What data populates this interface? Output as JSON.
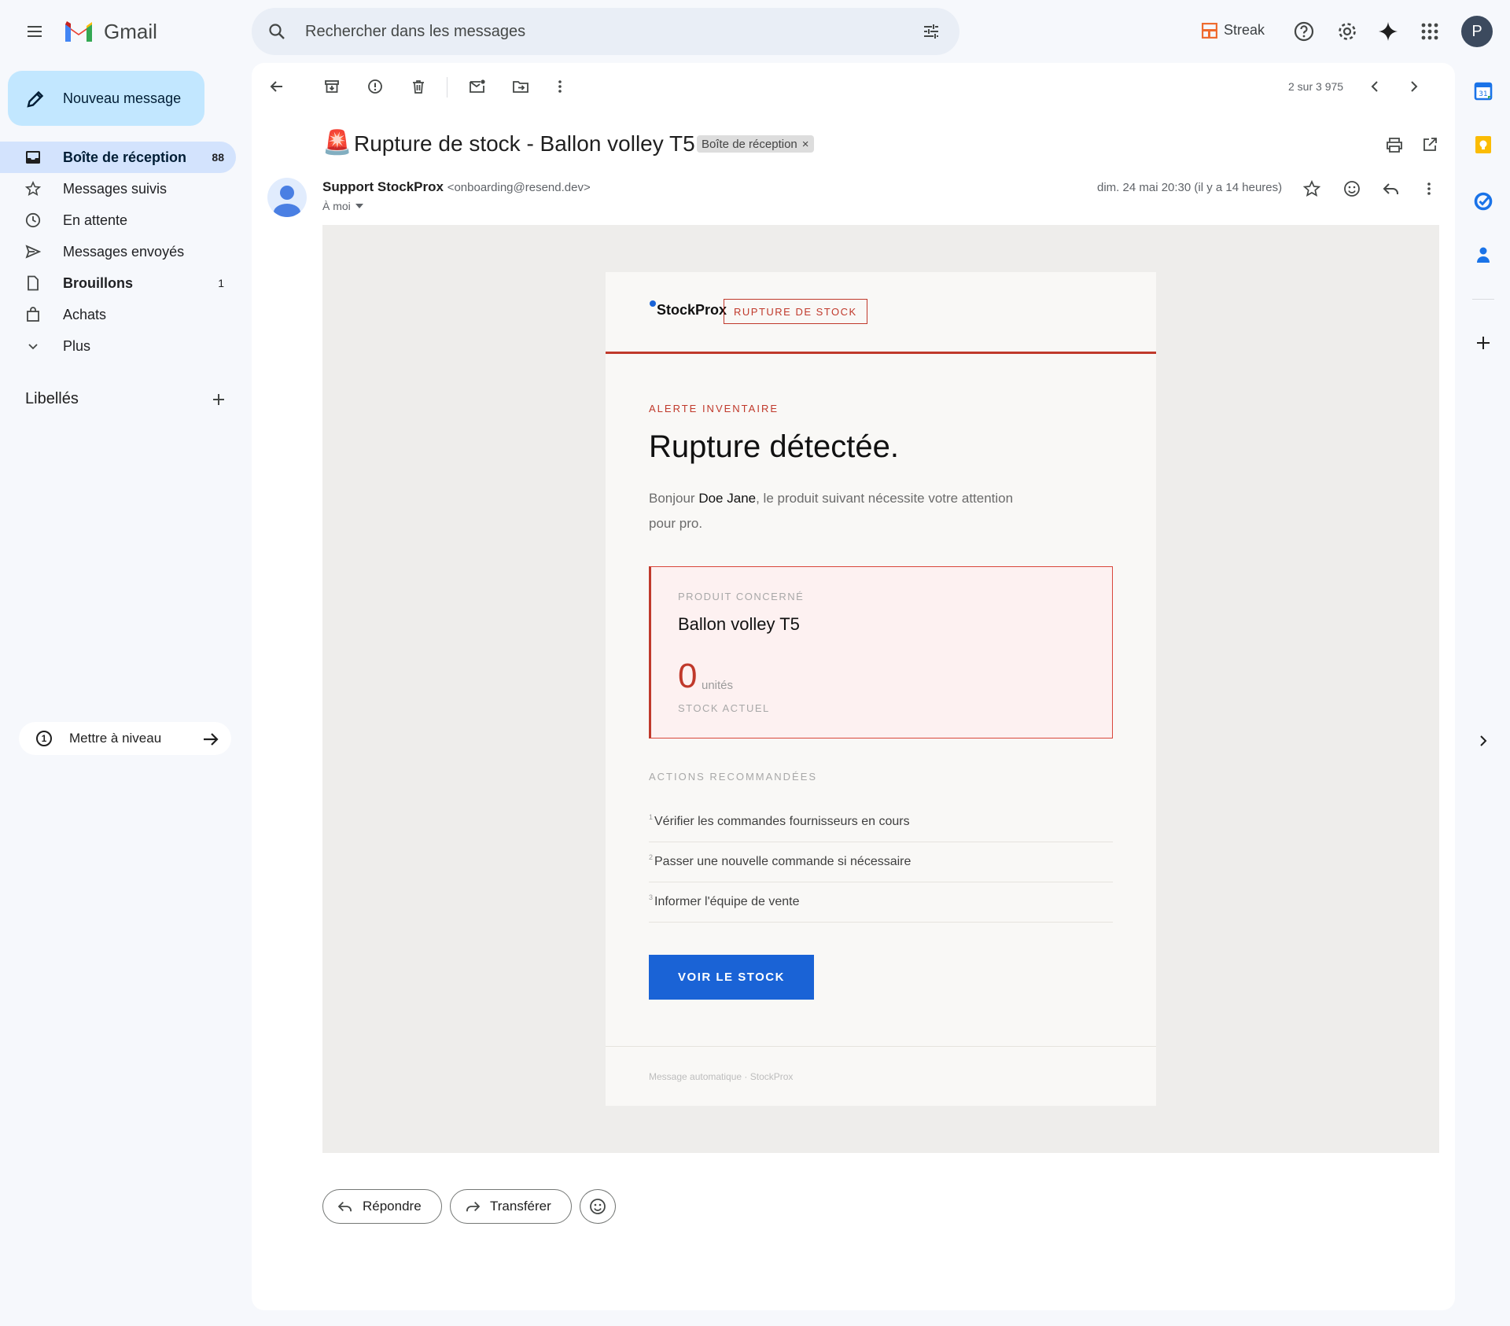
{
  "app": {
    "name": "Gmail",
    "avatar_letter": "P"
  },
  "search": {
    "placeholder": "Rechercher dans les messages"
  },
  "header": {
    "streak_label": "Streak"
  },
  "compose": {
    "label": "Nouveau message"
  },
  "sidebar": {
    "items": [
      {
        "label": "Boîte de réception",
        "count": "88",
        "active": true,
        "bold": true
      },
      {
        "label": "Messages suivis",
        "count": ""
      },
      {
        "label": "En attente",
        "count": ""
      },
      {
        "label": "Messages envoyés",
        "count": ""
      },
      {
        "label": "Brouillons",
        "count": "1",
        "bold": true
      },
      {
        "label": "Achats",
        "count": ""
      },
      {
        "label": "Plus",
        "count": ""
      }
    ],
    "labels_title": "Libellés",
    "upgrade_label": "Mettre à niveau",
    "upgrade_badge": "1"
  },
  "toolbar": {
    "pagination": "2 sur 3 975"
  },
  "message": {
    "subject": "Rupture de stock - Ballon volley T5",
    "subject_emoji": "🚨",
    "label_chip": "Boîte de réception",
    "label_chip_close": "×",
    "sender_name": "Support StockProx",
    "sender_email": "<onboarding@resend.dev>",
    "recipient": "À moi",
    "date": "dim. 24 mai 20:30 (il y a 14 heures)"
  },
  "email": {
    "brand": "StockProx",
    "badge": "RUPTURE DE STOCK",
    "kicker": "ALERTE INVENTAIRE",
    "headline": "Rupture détectée.",
    "greeting_start": "Bonjour ",
    "greeting_name": "Doe Jane",
    "greeting_rest": ", le produit suivant nécessite votre attention",
    "greeting_line2": "pour pro.",
    "product_label": "PRODUIT CONCERNÉ",
    "product_name": "Ballon volley T5",
    "stock_value": "0",
    "stock_unit": "unités",
    "stock_label": "STOCK ACTUEL",
    "actions_title": "ACTIONS RECOMMANDÉES",
    "actions": [
      {
        "num": "1",
        "text": "Vérifier les commandes fournisseurs en cours"
      },
      {
        "num": "2",
        "text": "Passer une nouvelle commande si nécessaire"
      },
      {
        "num": "3",
        "text": "Informer l'équipe de vente"
      }
    ],
    "cta": "VOIR LE STOCK",
    "footer": "Message automatique · StockProx"
  },
  "reply": {
    "reply_label": "Répondre",
    "forward_label": "Transférer"
  },
  "colors": {
    "accent_red": "#c0392b",
    "cta_blue": "#1a63d6",
    "compose_bg": "#c2e7ff",
    "active_nav": "#d3e3fd"
  }
}
